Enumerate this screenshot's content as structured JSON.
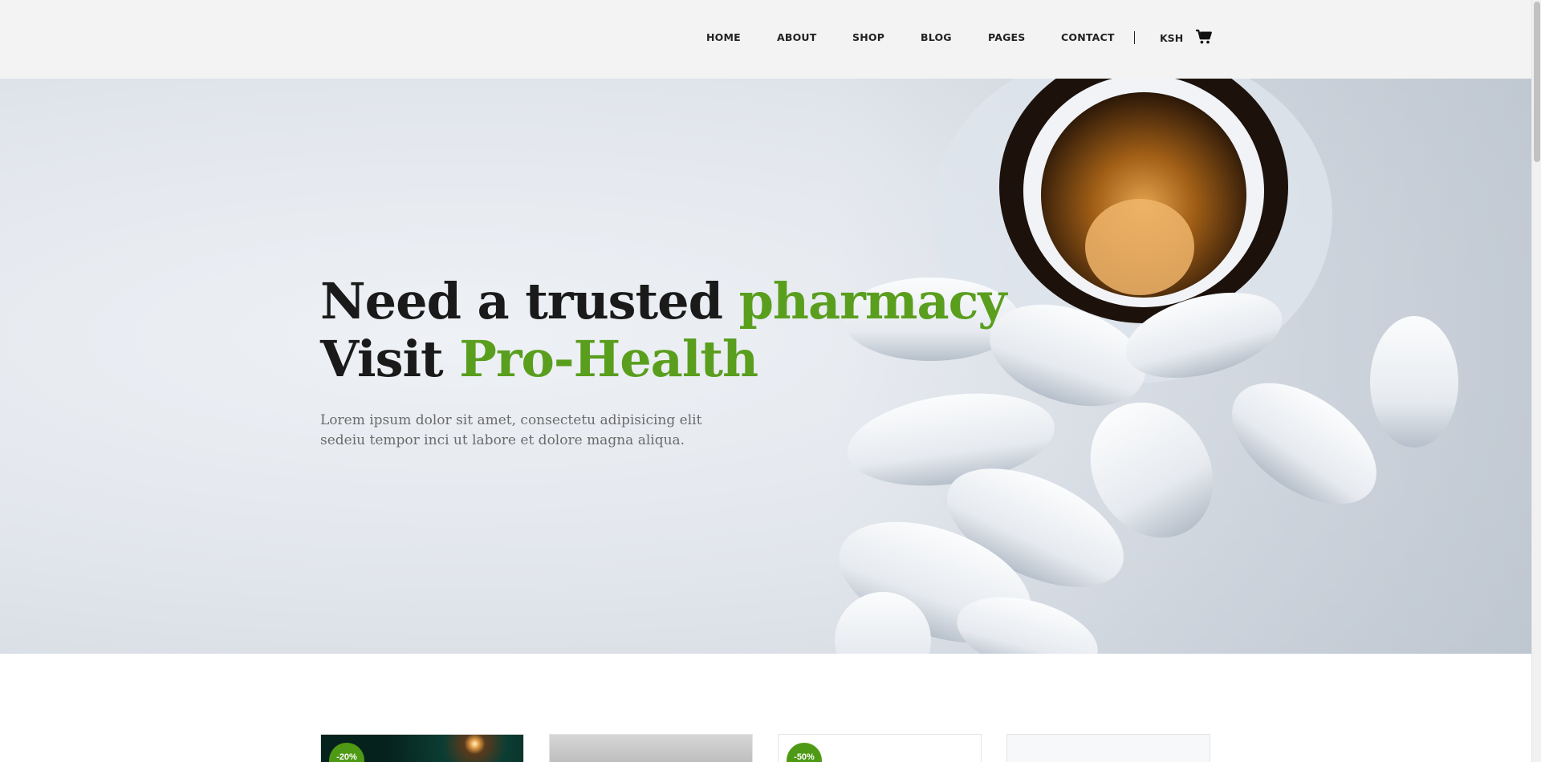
{
  "nav": {
    "items": [
      {
        "label": "HOME"
      },
      {
        "label": "ABOUT"
      },
      {
        "label": "SHOP"
      },
      {
        "label": "BLOG"
      },
      {
        "label": "PAGES"
      },
      {
        "label": "CONTACT"
      }
    ],
    "separator": "|",
    "currency": "KSH",
    "cart_icon": "shopping-cart-icon"
  },
  "hero": {
    "title_line1_plain": "Need a trusted ",
    "title_line1_accent": "pharmacy",
    "title_line2_plain": "Visit ",
    "title_line2_accent": "Pro-Health",
    "description": "Lorem ipsum dolor sit amet, consectetu adipisicing elit sedeiu tempor inci ut labore et dolore magna aliqua.",
    "accent_color": "#5a9e1e"
  },
  "products": [
    {
      "badge": "-20%"
    },
    {
      "badge": ""
    },
    {
      "badge": "-50%"
    },
    {
      "badge": ""
    }
  ],
  "colors": {
    "header_bg": "#f3f3f3",
    "badge_bg": "#4f9a15",
    "text_dark": "#1a1a1a"
  }
}
